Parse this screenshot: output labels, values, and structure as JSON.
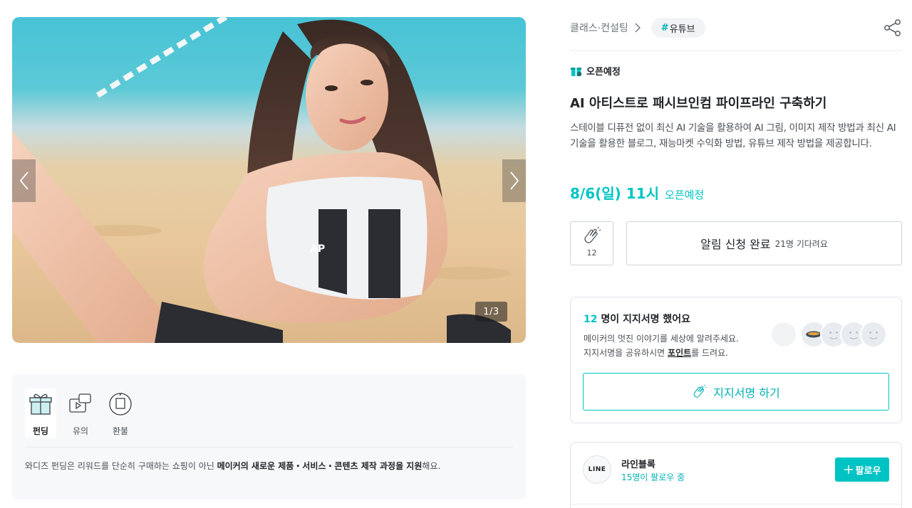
{
  "gallery": {
    "image_alt": "Project key visual",
    "prev_icon": "chevron-left-icon",
    "next_icon": "chevron-right-icon",
    "counter": "1/3"
  },
  "info": {
    "tabs": [
      {
        "label": "펀딩",
        "icon": "gift-icon",
        "active": true
      },
      {
        "label": "유의",
        "icon": "video-notice-icon",
        "active": false
      },
      {
        "label": "환불",
        "icon": "refund-icon",
        "active": false
      }
    ],
    "description_prefix": "와디즈 펀딩은 리워드를 단순히 구매하는 쇼핑이 아닌 ",
    "description_bold": "메이커의 새로운 제품・서비스・콘텐츠 제작 과정을 지원",
    "description_suffix": "해요."
  },
  "breadcrumb": {
    "category": "클래스·컨설팅",
    "tag_hash": "#",
    "tag": "유튜브"
  },
  "status": {
    "icon": "gift-badge-icon",
    "label": "오픈예정"
  },
  "project": {
    "title": "AI 아티스트로 패시브인컴 파이프라인 구축하기",
    "description": "스테이블 디퓨전 없이 최신 AI 기술을 활용하여 AI 그림, 이미지 제작 방법과 최신 AI 기술을 활용한 블로그, 재능마켓 수익화 방법, 유튜브 제작 방법을 제공합니다.",
    "open_date": "8/6(일) 11시",
    "open_label": "오픈예정"
  },
  "actions": {
    "clap_count": "12",
    "notify_label": "알림 신청 완료",
    "notify_sub": "21명 기다려요"
  },
  "support": {
    "count": "12",
    "title_suffix": " 명이 지지서명 했어요",
    "line1": "메이커의 멋진 이야기를 세상에 알려주세요.",
    "line2_prefix": "지지서명을 공유하시면 ",
    "line2_bold": "포인트",
    "line2_suffix": "를 드려요.",
    "button_label": "지지서명 하기"
  },
  "maker": {
    "logo_text": "LINE",
    "name": "라인블록",
    "followers": "15명이 팔로우 중",
    "follow_label": "팔로우"
  },
  "colors": {
    "accent": "#00c4c4",
    "accent_dark": "#00b2b2",
    "text": "#212529",
    "muted": "#495057"
  }
}
